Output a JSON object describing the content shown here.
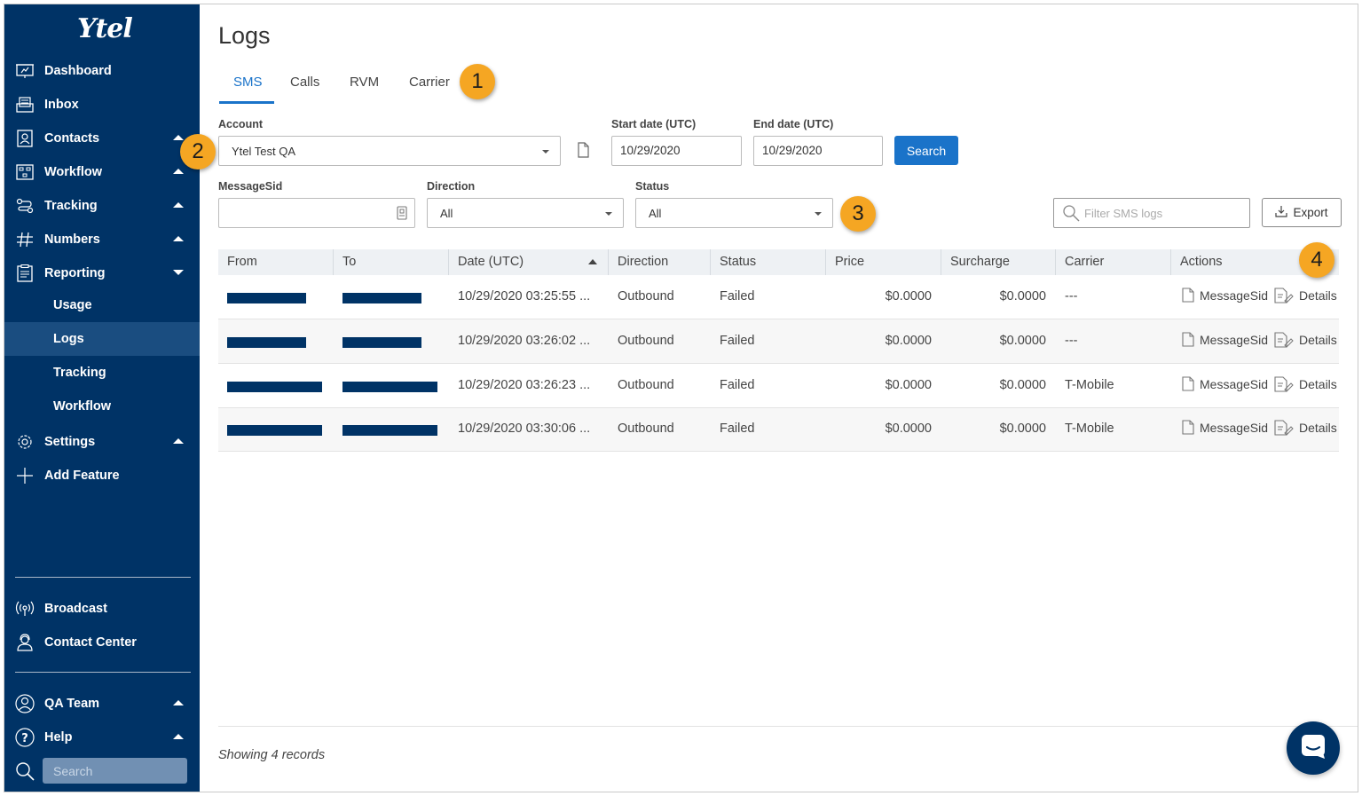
{
  "app": {
    "logo_text": "Ytel"
  },
  "sidebar": {
    "items": [
      {
        "label": "Dashboard",
        "icon": "dashboard-icon"
      },
      {
        "label": "Inbox",
        "icon": "inbox-icon"
      },
      {
        "label": "Contacts",
        "icon": "contacts-icon"
      },
      {
        "label": "Workflow",
        "icon": "workflow-icon"
      },
      {
        "label": "Tracking",
        "icon": "tracking-icon"
      },
      {
        "label": "Numbers",
        "icon": "hash-icon"
      },
      {
        "label": "Reporting",
        "icon": "reporting-icon"
      }
    ],
    "reporting_sub": [
      "Usage",
      "Logs",
      "Tracking",
      "Workflow"
    ],
    "settings": "Settings",
    "add_feature": "Add Feature",
    "broadcast": "Broadcast",
    "contact_center": "Contact Center",
    "team": "QA Team",
    "help": "Help",
    "search_placeholder": "Search"
  },
  "page": {
    "title": "Logs",
    "tabs": [
      "SMS",
      "Calls",
      "RVM",
      "Carrier"
    ],
    "active_tab": "SMS"
  },
  "callouts": [
    "1",
    "2",
    "3",
    "4"
  ],
  "filters": {
    "account_label": "Account",
    "account_value": "Ytel Test QA",
    "start_label": "Start date (UTC)",
    "start_value": "10/29/2020",
    "end_label": "End date (UTC)",
    "end_value": "10/29/2020",
    "search_button": "Search",
    "messagesid_label": "MessageSid",
    "messagesid_value": "",
    "direction_label": "Direction",
    "direction_value": "All",
    "status_label": "Status",
    "status_value": "All",
    "filter_placeholder": "Filter SMS logs",
    "export_button": "Export"
  },
  "table": {
    "columns": [
      "From",
      "To",
      "Date (UTC)",
      "Direction",
      "Status",
      "Price",
      "Surcharge",
      "Carrier",
      "Actions"
    ],
    "rows": [
      {
        "date": "10/29/2020 03:25:55 ...",
        "direction": "Outbound",
        "status": "Failed",
        "price": "$0.0000",
        "surcharge": "$0.0000",
        "carrier": "---"
      },
      {
        "date": "10/29/2020 03:26:02 ...",
        "direction": "Outbound",
        "status": "Failed",
        "price": "$0.0000",
        "surcharge": "$0.0000",
        "carrier": "---"
      },
      {
        "date": "10/29/2020 03:26:23 ...",
        "direction": "Outbound",
        "status": "Failed",
        "price": "$0.0000",
        "surcharge": "$0.0000",
        "carrier": "T-Mobile"
      },
      {
        "date": "10/29/2020 03:30:06 ...",
        "direction": "Outbound",
        "status": "Failed",
        "price": "$0.0000",
        "surcharge": "$0.0000",
        "carrier": "T-Mobile"
      }
    ],
    "action_messagesid": "MessageSid",
    "action_details": "Details"
  },
  "footer": {
    "records": "Showing 4 records"
  },
  "colors": {
    "sidebar": "#003366",
    "accent": "#1a73c9",
    "callout": "#f5a623"
  }
}
